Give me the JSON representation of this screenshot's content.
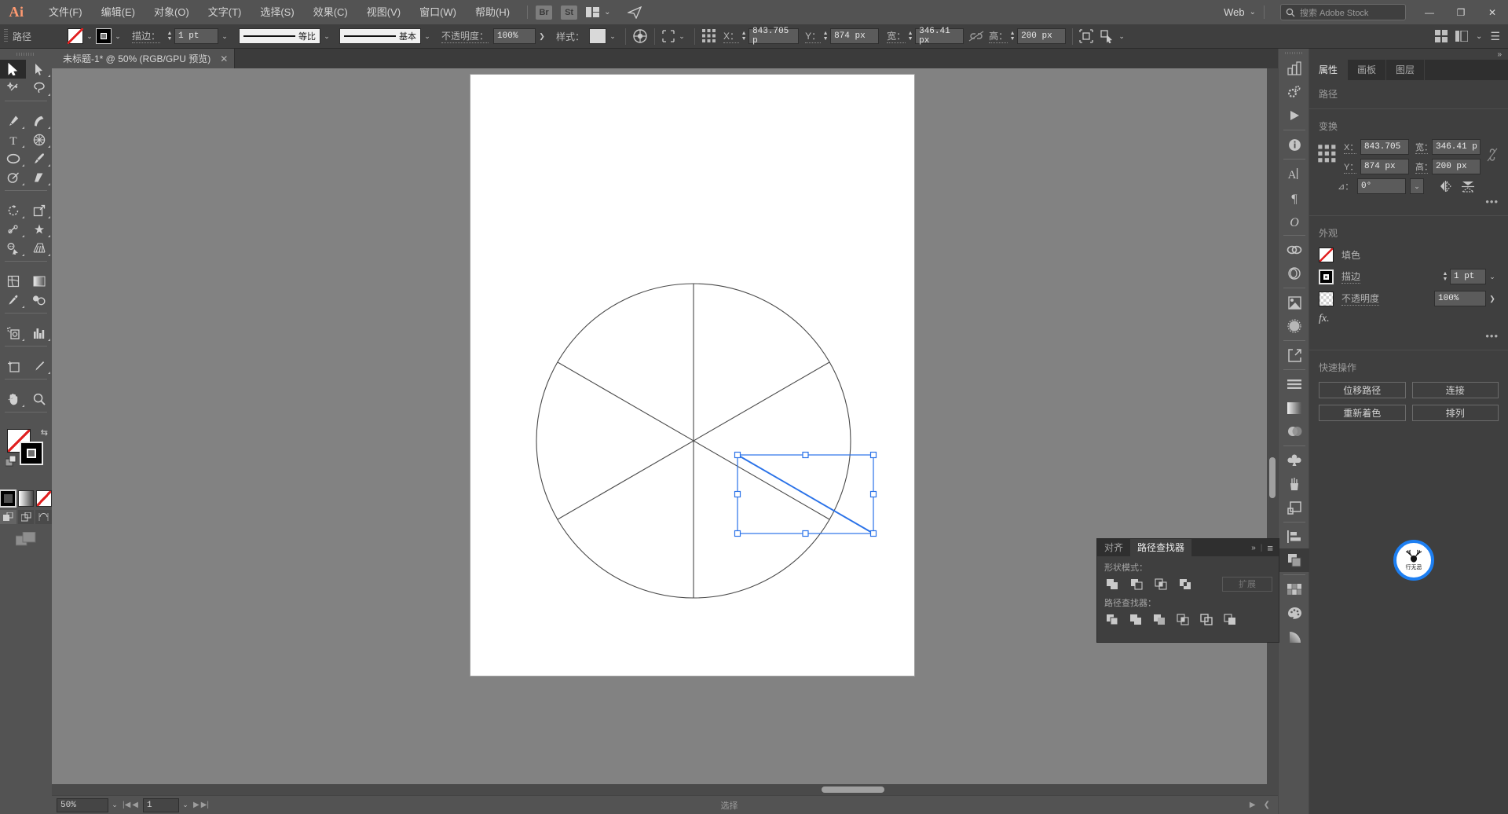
{
  "app": {
    "name": "Adobe Illustrator",
    "logo_text": "Ai"
  },
  "menubar": {
    "items": [
      {
        "label": "文件(F)"
      },
      {
        "label": "编辑(E)"
      },
      {
        "label": "对象(O)"
      },
      {
        "label": "文字(T)"
      },
      {
        "label": "选择(S)"
      },
      {
        "label": "效果(C)"
      },
      {
        "label": "视图(V)"
      },
      {
        "label": "窗口(W)"
      },
      {
        "label": "帮助(H)"
      }
    ],
    "bridge_badge": "Br",
    "stock_badge": "St",
    "workspace": "Web",
    "search_placeholder": "搜索 Adobe Stock",
    "window_buttons": {
      "minimize": "—",
      "restore": "❐",
      "close": "✕"
    }
  },
  "controlbar": {
    "object_label": "路径",
    "fill_icon": "no-fill-swatch",
    "stroke_icon": "stroke-swatch",
    "stroke_label": "描边：",
    "stroke_weight": "1 pt",
    "variable_width_profile": "等比",
    "brush_definition": "基本",
    "opacity_label": "不透明度：",
    "opacity_value": "100%",
    "style_label": "样式：",
    "transform": {
      "x_label": "X：",
      "x_value": "843.705 p",
      "y_label": "Y：",
      "y_value": "874 px",
      "w_label": "宽：",
      "w_value": "346.41 px",
      "h_label": "高：",
      "h_value": "200 px"
    }
  },
  "toolbar": {
    "tools": [
      {
        "name": "selection-tool",
        "label": "选择工具",
        "active": true
      },
      {
        "name": "direct-selection-tool",
        "label": "直接选择工具",
        "active": false
      },
      {
        "name": "magic-wand-tool",
        "label": "魔棒工具",
        "active": false
      },
      {
        "name": "lasso-tool",
        "label": "套索工具",
        "active": false
      },
      {
        "name": "pen-tool",
        "label": "钢笔工具",
        "active": false
      },
      {
        "name": "curvature-tool",
        "label": "曲率工具",
        "active": false
      },
      {
        "name": "type-tool",
        "label": "文字工具",
        "active": false
      },
      {
        "name": "line-segment-tool",
        "label": "直线段工具",
        "active": false
      },
      {
        "name": "ellipse-tool",
        "label": "椭圆工具",
        "active": false
      },
      {
        "name": "paintbrush-tool",
        "label": "画笔工具",
        "active": false
      },
      {
        "name": "shaper-tool",
        "label": "Shaper 工具",
        "active": false
      },
      {
        "name": "eraser-tool",
        "label": "橡皮擦工具",
        "active": false
      },
      {
        "name": "rotate-tool",
        "label": "旋转工具",
        "active": false
      },
      {
        "name": "scale-tool",
        "label": "比例缩放工具",
        "active": false
      },
      {
        "name": "width-tool",
        "label": "宽度工具",
        "active": false
      },
      {
        "name": "free-transform-tool",
        "label": "自由变换工具",
        "active": false
      },
      {
        "name": "shape-builder-tool",
        "label": "形状生成器工具",
        "active": false
      },
      {
        "name": "perspective-grid-tool",
        "label": "透视网格工具",
        "active": false
      },
      {
        "name": "mesh-tool",
        "label": "网格工具",
        "active": false
      },
      {
        "name": "gradient-tool",
        "label": "渐变工具",
        "active": false
      },
      {
        "name": "eyedropper-tool",
        "label": "吸管工具",
        "active": false
      },
      {
        "name": "blend-tool",
        "label": "混合工具",
        "active": false
      },
      {
        "name": "symbol-sprayer-tool",
        "label": "符号喷枪工具",
        "active": false
      },
      {
        "name": "column-graph-tool",
        "label": "柱形图工具",
        "active": false
      },
      {
        "name": "artboard-tool",
        "label": "画板工具",
        "active": false
      },
      {
        "name": "slice-tool",
        "label": "切片工具",
        "active": false
      },
      {
        "name": "hand-tool",
        "label": "抓手工具",
        "active": false
      },
      {
        "name": "zoom-tool",
        "label": "缩放工具",
        "active": false
      }
    ],
    "fill_swatch": "none",
    "stroke_swatch": "black",
    "color_modes": [
      "color",
      "gradient",
      "none"
    ],
    "draw_modes": [
      "draw-normal",
      "draw-behind",
      "draw-inside"
    ],
    "screen_mode": "screen-mode-toggle"
  },
  "document": {
    "tab_title": "未标题-1* @ 50% (RGB/GPU 预览)",
    "close_label": "✕"
  },
  "statusbar": {
    "zoom_value": "50%",
    "page_value": "1",
    "status_text": "选择",
    "first_label": "|◀",
    "prev_label": "◀",
    "next_label": "▶",
    "last_label": "▶|"
  },
  "icon_dock": {
    "items": [
      {
        "name": "libraries-icon",
        "label": "库"
      },
      {
        "name": "properties-gear-icon",
        "label": "属性"
      },
      {
        "name": "actions-play-icon",
        "label": "动作"
      },
      {
        "name": "document-info-icon",
        "label": "文档信息"
      },
      {
        "name": "character-icon",
        "label": "字符"
      },
      {
        "name": "paragraph-icon",
        "label": "段落"
      },
      {
        "name": "glyphs-icon",
        "label": "字形"
      },
      {
        "name": "links-icon",
        "label": "链接"
      },
      {
        "name": "image-trace-icon",
        "label": "图像描摹"
      },
      {
        "name": "symbols-icon",
        "label": "符号"
      },
      {
        "name": "brushes-dot-icon",
        "label": "画笔"
      },
      {
        "name": "asset-export-icon",
        "label": "资源导出"
      },
      {
        "name": "layers-lines-icon",
        "label": "图层"
      },
      {
        "name": "gradient-icon",
        "label": "渐变"
      },
      {
        "name": "transparency-icon",
        "label": "透明度"
      },
      {
        "name": "swatches-club-icon",
        "label": "色板"
      },
      {
        "name": "brush-pot-icon",
        "label": "画笔库"
      },
      {
        "name": "appearance-icon",
        "label": "外观"
      },
      {
        "name": "align-icon",
        "label": "对齐"
      },
      {
        "name": "pathfinder-icon",
        "label": "路径查找器",
        "selected": true
      },
      {
        "name": "color-guide-icon",
        "label": "颜色参考"
      },
      {
        "name": "color-palette-icon",
        "label": "颜色"
      },
      {
        "name": "gradient-fan-icon",
        "label": "渐变批注"
      }
    ]
  },
  "properties_panel": {
    "collapse_icon": "»",
    "tabs": [
      {
        "label": "属性",
        "active": true
      },
      {
        "label": "画板",
        "active": false
      },
      {
        "label": "图层",
        "active": false
      }
    ],
    "object_type": "路径",
    "transform": {
      "title": "变换",
      "x_label": "X：",
      "x_value": "843.705",
      "y_label": "Y：",
      "y_value": "874 px",
      "w_label": "宽：",
      "w_value": "346.41 p",
      "h_label": "高：",
      "h_value": "200 px",
      "angle_label": "⊿：",
      "angle_value": "0°",
      "link_icon": "link-broken-icon",
      "flip_h_icon": "flip-horizontal-icon",
      "flip_v_icon": "flip-vertical-icon",
      "more_options": "•••"
    },
    "appearance": {
      "title": "外观",
      "fill_label": "填色",
      "stroke_label": "描边",
      "stroke_value": "1 pt",
      "opacity_label": "不透明度",
      "opacity_value": "100%",
      "fx_label": "fx.",
      "more_options": "•••"
    },
    "quick_actions": {
      "title": "快速操作",
      "buttons": [
        {
          "label": "位移路径"
        },
        {
          "label": "连接"
        },
        {
          "label": "重新着色"
        },
        {
          "label": "排列"
        }
      ]
    }
  },
  "pathfinder_panel": {
    "tabs": [
      {
        "label": "对齐",
        "active": false
      },
      {
        "label": "路径查找器",
        "active": true
      }
    ],
    "collapse_icon": "»",
    "menu_icon": "≡",
    "shape_modes_label": "形状模式：",
    "shape_modes": [
      {
        "name": "unite-button",
        "label": "联集"
      },
      {
        "name": "minus-front-button",
        "label": "减去顶层"
      },
      {
        "name": "intersect-button",
        "label": "交集"
      },
      {
        "name": "exclude-button",
        "label": "差集"
      }
    ],
    "expand_label": "扩展",
    "pathfinders_label": "路径查找器：",
    "pathfinders": [
      {
        "name": "divide-button",
        "label": "分割"
      },
      {
        "name": "trim-button",
        "label": "修边"
      },
      {
        "name": "merge-button",
        "label": "合并"
      },
      {
        "name": "crop-button",
        "label": "裁剪"
      },
      {
        "name": "outline-button",
        "label": "轮廓"
      },
      {
        "name": "minus-back-button",
        "label": "减去后方对象"
      }
    ]
  },
  "canvas": {
    "artboard_background": "#ffffff",
    "canvas_background": "#828282",
    "selection_color": "#2a72e8",
    "artwork_stroke": "#4a4a4a",
    "description": "圆形被分割为六个扇形，右下扇形的弦被选中（三角形路径）"
  },
  "watermark": {
    "text": "行无忌",
    "ring_color": "#1d7ff2"
  },
  "colors": {
    "menu_bg": "#535353",
    "panel_bg": "#3f3f3f",
    "field_bg": "#5b5b5b",
    "accent_blue": "#2a72e8",
    "logo_orange": "#ff9a71"
  }
}
